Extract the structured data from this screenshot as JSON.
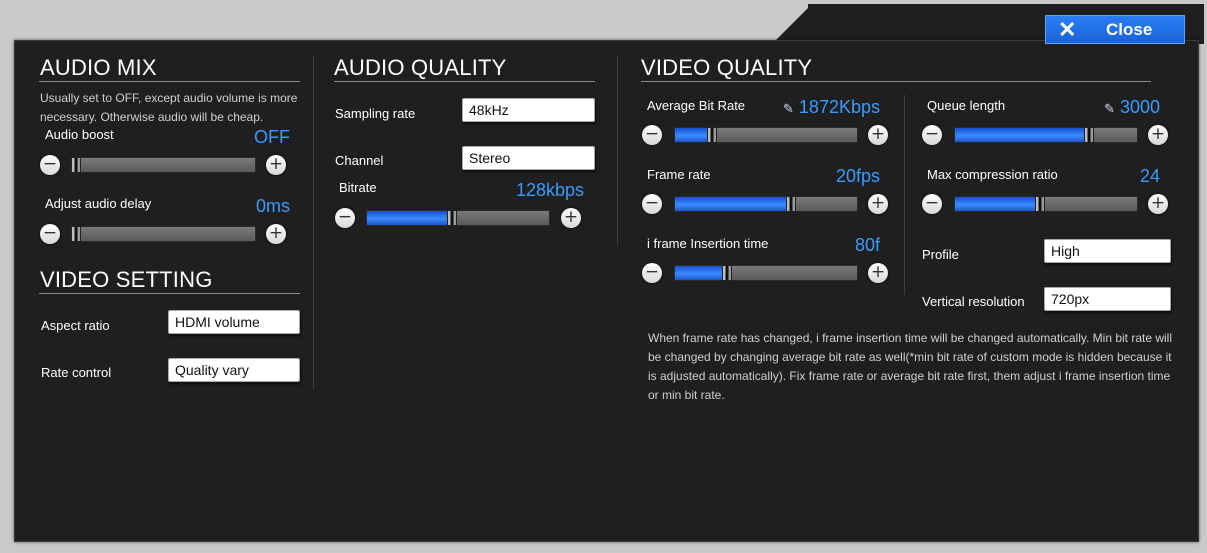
{
  "close_button": {
    "icon": "close-icon",
    "label": "Close"
  },
  "audio_mix": {
    "heading": "AUDIO MIX",
    "note": "Usually set to OFF, except audio volume is more necessary. Otherwise audio will be cheap.",
    "audio_boost": {
      "label": "Audio boost",
      "value": "OFF",
      "level": 0.02
    },
    "audio_delay": {
      "label": "Adjust audio delay",
      "value": "0ms",
      "level": 0.02
    }
  },
  "video_setting": {
    "heading": "VIDEO SETTING",
    "aspect_ratio": {
      "label": "Aspect ratio",
      "value": "HDMI volume"
    },
    "rate_control": {
      "label": "Rate control",
      "value": "Quality vary"
    }
  },
  "audio_quality": {
    "heading": "AUDIO QUALITY",
    "sampling_rate": {
      "label": "Sampling rate",
      "value": "48kHz"
    },
    "channel": {
      "label": "Channel",
      "value": "Stereo"
    },
    "bitrate": {
      "label": "Bitrate",
      "value": "128kbps",
      "level": 0.46
    }
  },
  "video_quality": {
    "heading": "VIDEO QUALITY",
    "average_bit_rate": {
      "label": "Average Bit Rate",
      "value": "1872Kbps",
      "level": 0.2,
      "icon": "pencil-icon"
    },
    "frame_rate": {
      "label": "Frame rate",
      "value": "20fps",
      "level": 0.63
    },
    "iframe_insertion": {
      "label": "i frame Insertion time",
      "value": "80f",
      "level": 0.28
    },
    "queue_length": {
      "label": "Queue length",
      "value": "3000",
      "level": 0.73,
      "icon": "pencil-icon"
    },
    "max_compression": {
      "label": "Max compression ratio",
      "value": "24",
      "level": 0.46
    },
    "profile": {
      "label": "Profile",
      "value": "High"
    },
    "vertical_resolution": {
      "label": "Vertical resolution",
      "value": "720px"
    },
    "note": "When frame rate has changed, i frame insertion time will be changed automatically. Min bit rate will be changed by changing average bit rate as well(*min bit rate of custom mode is hidden because it is adjusted automatically). Fix frame rate or average bit rate first, them adjust i frame insertion time or min bit rate."
  },
  "colors": {
    "accent": "#3a9bff",
    "panel": "#1f1f1f",
    "button": "#2b7ef5"
  }
}
